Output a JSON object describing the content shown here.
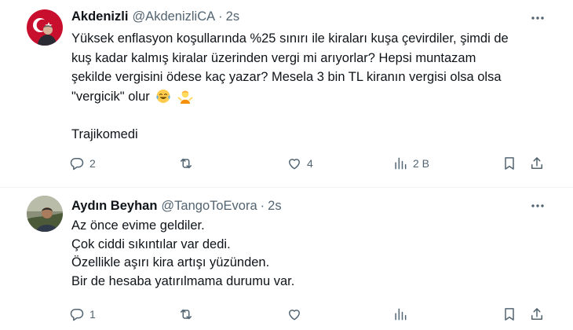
{
  "tweets": [
    {
      "author": "Akdenizli",
      "handle": "@AkdenizliCA",
      "separator": "·",
      "time": "2s",
      "lines": [
        "Yüksek enflasyon koşullarında %25 sınırı ile kiraları kuşa çevirdiler, şimdi de",
        "kuş kadar kalmış kiralar üzerinden vergi mi arıyorlar? Hepsi muntazam",
        "şekilde vergisini ödese kaç yazar? Mesela 3 bin TL kiranın vergisi olsa olsa",
        "\"vergicik\" olur"
      ],
      "emojis": [
        "tears-of-joy-emoji",
        "person-shrugging-emoji"
      ],
      "extra_line": "Trajikomedi",
      "stats": {
        "replies": "2",
        "retweets": "",
        "likes": "4",
        "views": "2 B"
      }
    },
    {
      "author": "Aydın Beyhan",
      "handle": "@TangoToEvora",
      "separator": "·",
      "time": "2s",
      "lines": [
        "Az önce evime geldiler.",
        "Çok ciddi sıkıntılar var dedi.",
        "Özellikle aşırı kira artışı yüzünden.",
        "Bir de hesaba yatırılmama durumu var."
      ],
      "stats": {
        "replies": "1",
        "retweets": "",
        "likes": "",
        "views": ""
      }
    }
  ],
  "colors": {
    "text": "#0f1419",
    "muted": "#536471",
    "divider": "#eff3f4",
    "background": "#ffffff"
  }
}
